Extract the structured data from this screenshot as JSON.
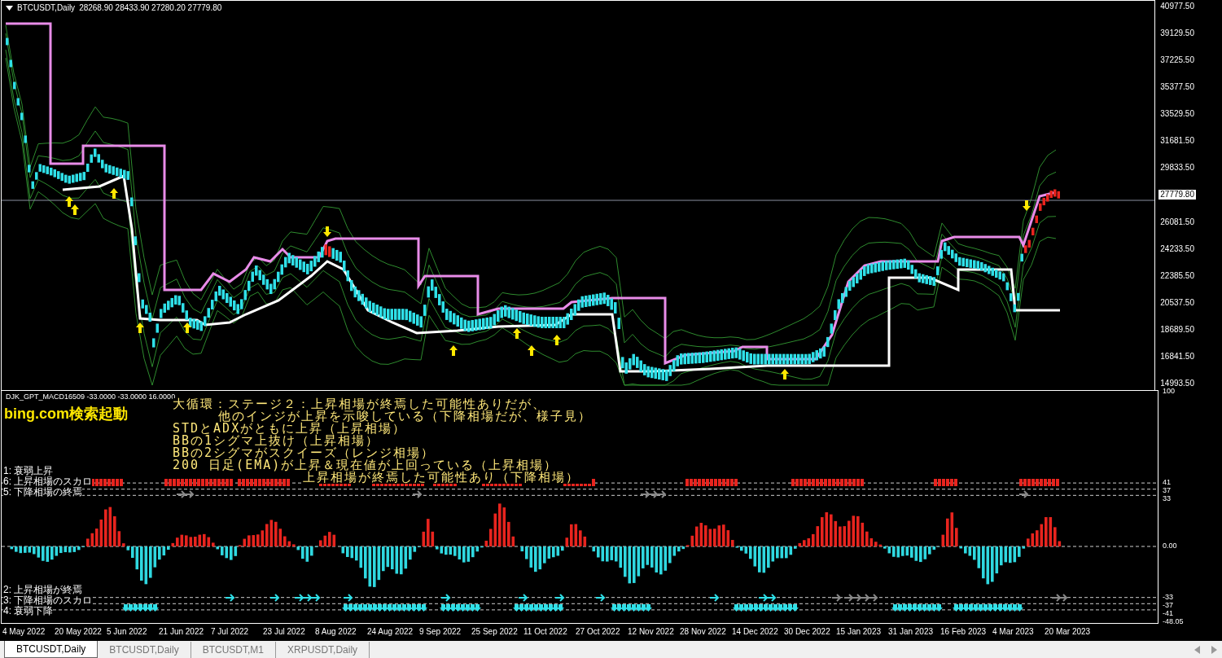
{
  "main_pane": {
    "symbol": "BTCUSDT,Daily",
    "ohlc": "28268.90 28433.90 27280.20 27779.80",
    "price_axis": [
      {
        "label": "40977.50",
        "kind": "tick"
      },
      {
        "label": "39129.50",
        "kind": "tick"
      },
      {
        "label": "37225.50",
        "kind": "tick"
      },
      {
        "label": "35377.50",
        "kind": "tick"
      },
      {
        "label": "33529.50",
        "kind": "tick"
      },
      {
        "label": "31681.50",
        "kind": "tick"
      },
      {
        "label": "29833.50",
        "kind": "tick"
      },
      {
        "label": "27779.80",
        "kind": "current"
      },
      {
        "label": "26081.50",
        "kind": "tick"
      },
      {
        "label": "24233.50",
        "kind": "tick"
      },
      {
        "label": "22385.50",
        "kind": "tick"
      },
      {
        "label": "20537.50",
        "kind": "tick"
      },
      {
        "label": "18689.50",
        "kind": "tick"
      },
      {
        "label": "16841.50",
        "kind": "tick"
      },
      {
        "label": "14993.50",
        "kind": "tick"
      }
    ]
  },
  "indicator_pane": {
    "title": "DJK_GPT_MACD16509 -33.0000 -33.0000 16.0000",
    "search_label": "bing.com検索起動",
    "messages": [
      {
        "text": "大循環：ステージ２：上昇相場が終焉した可能性ありだが、",
        "kind": "main"
      },
      {
        "text": "他のインジが上昇を示唆している（下降相場だが、様子見）",
        "kind": "continuation"
      },
      {
        "text": "STDとADXがともに上昇（上昇相場）",
        "kind": "main"
      },
      {
        "text": "BBの1シグマ上抜け（上昇相場）",
        "kind": "main"
      },
      {
        "text": "BBの2シグマがスクイーズ（レンジ相場）",
        "kind": "main"
      },
      {
        "text": "200 日足(EMA)が上昇＆現在値が上回っている（上昇相場）",
        "kind": "main"
      },
      {
        "text": "上昇相場が終焉した可能性あり（下降相場）",
        "kind": "partial"
      }
    ],
    "upper_labels": [
      "1: 衰弱上昇",
      "6: 上昇相場のスカロ",
      "5: 下降相場の終焉"
    ],
    "lower_labels": [
      "2: 上昇相場が終焉",
      "3: 下降相場のスカロ",
      "4: 衰弱下降"
    ],
    "axis": [
      "100",
      "41",
      "37",
      "33",
      "0.00",
      "-33",
      "-37",
      "-41",
      "-48.05"
    ]
  },
  "time_axis": [
    "4 May 2022",
    "20 May 2022",
    "5 Jun 2022",
    "21 Jun 2022",
    "7 Jul 2022",
    "23 Jul 2022",
    "8 Aug 2022",
    "24 Aug 2022",
    "9 Sep 2022",
    "25 Sep 2022",
    "11 Oct 2022",
    "27 Oct 2022",
    "12 Nov 2022",
    "28 Nov 2022",
    "14 Dec 2022",
    "30 Dec 2022",
    "15 Jan 2023",
    "31 Jan 2023",
    "16 Feb 2023",
    "4 Mar 2023",
    "20 Mar 2023"
  ],
  "tabs": [
    {
      "label": "BTCUSDT,Daily",
      "selected": true
    },
    {
      "label": "BTCUSDT,Daily",
      "selected": false
    },
    {
      "label": "BTCUSDT,M1",
      "selected": false
    },
    {
      "label": "XRPUSDT,Daily",
      "selected": false
    }
  ]
}
